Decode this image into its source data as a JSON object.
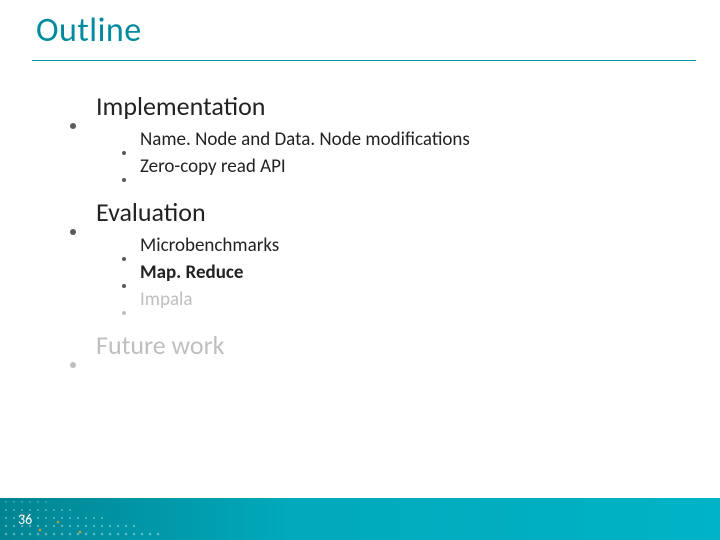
{
  "title": "Outline",
  "page_number": "36",
  "colors": {
    "accent": "#008a9e",
    "footer_start": "#008493",
    "footer_end": "#00b3c6",
    "dim": "#bfbfbf"
  },
  "bullets": [
    {
      "label": "Implementation",
      "dim": false,
      "children": [
        {
          "label": "Name. Node and Data. Node modifications",
          "dim": false,
          "bold": false
        },
        {
          "label": "Zero-copy read API",
          "dim": false,
          "bold": false
        }
      ]
    },
    {
      "label": "Evaluation",
      "dim": false,
      "children": [
        {
          "label": "Microbenchmarks",
          "dim": false,
          "bold": false
        },
        {
          "label": "Map. Reduce",
          "dim": false,
          "bold": true
        },
        {
          "label": "Impala",
          "dim": true,
          "bold": false
        }
      ]
    },
    {
      "label": "Future work",
      "dim": true,
      "children": []
    }
  ]
}
